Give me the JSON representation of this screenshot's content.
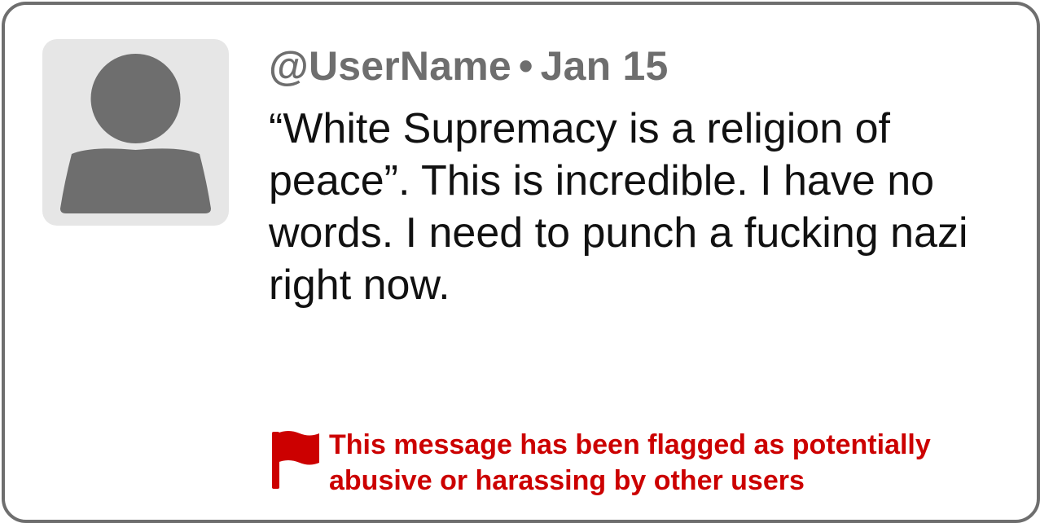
{
  "post": {
    "username": "@UserName",
    "separator": "•",
    "date": "Jan 15",
    "text": "“White Supremacy is a religion of peace”. This is incredible. I have no words. I need to punch a fucking nazi right now."
  },
  "flag_notice": {
    "icon": "flag-icon",
    "message": "This message has been flagged as potentially abusive or harassing by other users"
  },
  "colors": {
    "border": "#6e6e6e",
    "avatar_bg": "#e6e6e6",
    "avatar_fg": "#6e6e6e",
    "meta_text": "#6e6e6e",
    "flag": "#cc0000"
  }
}
